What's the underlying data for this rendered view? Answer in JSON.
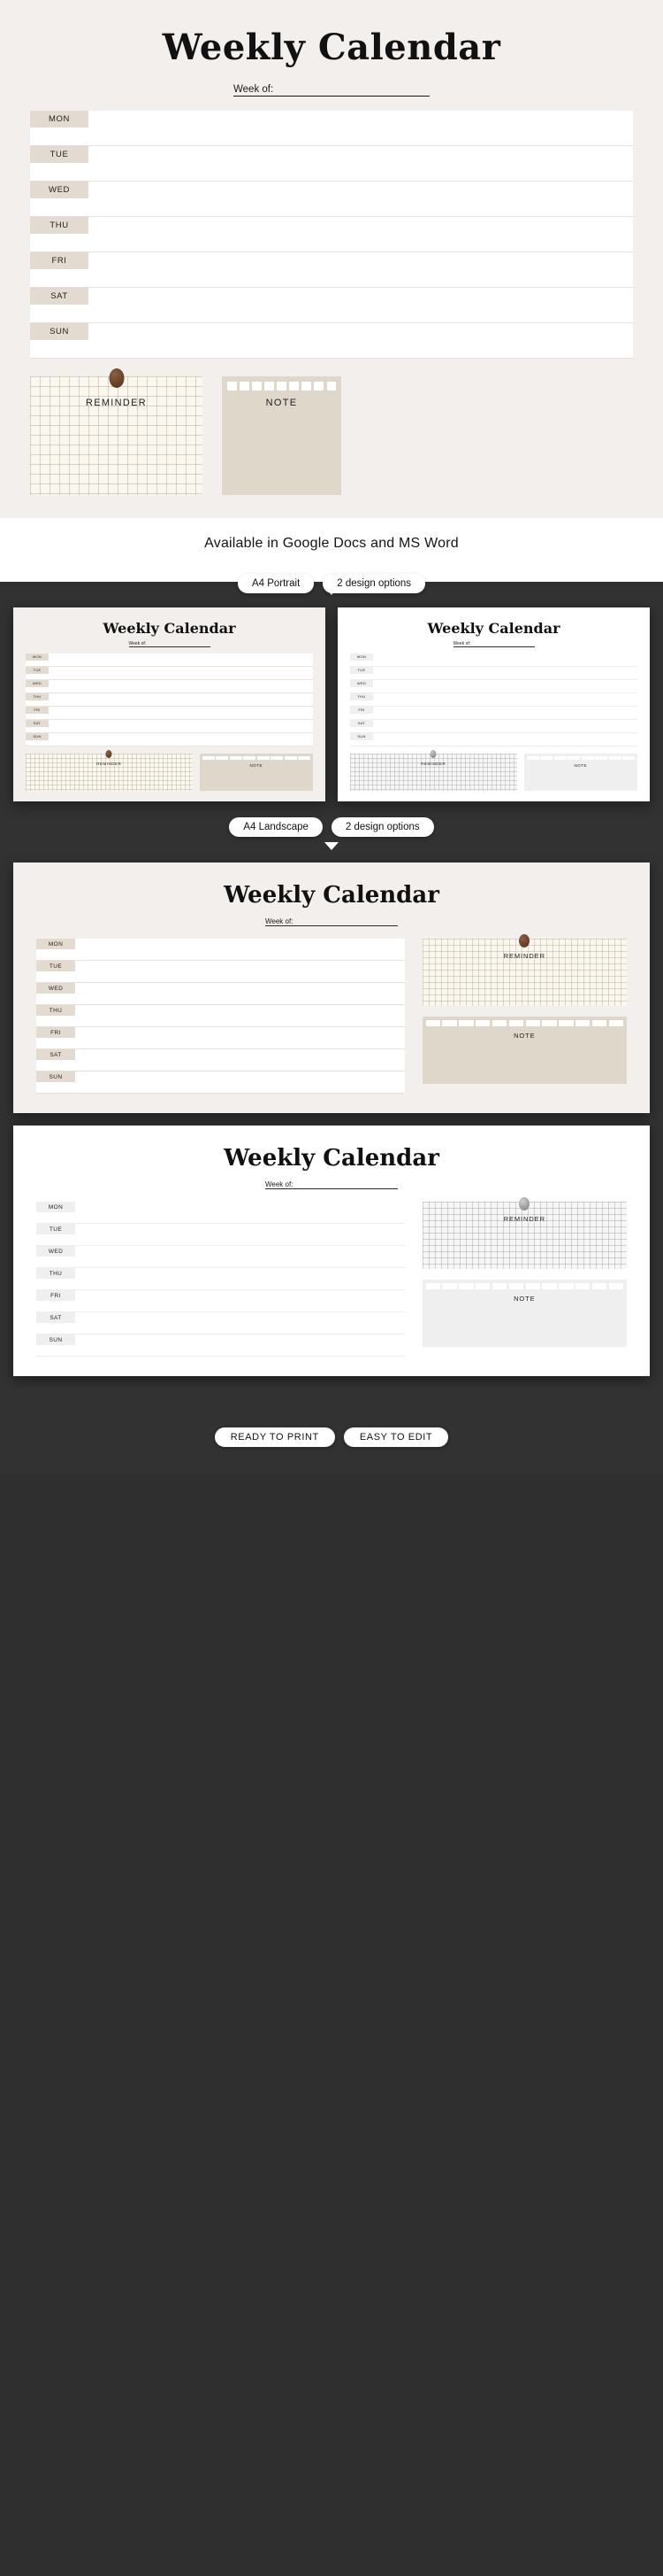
{
  "hero": {
    "title": "Weekly Calendar",
    "week_of_label": "Week of:",
    "days": [
      "MON",
      "TUE",
      "WED",
      "THU",
      "FRI",
      "SAT",
      "SUN"
    ],
    "reminder_label": "REMINDER",
    "note_label": "NOTE",
    "note_tab_count": 9,
    "colors": {
      "background": "#f2efec",
      "day_chip": "#e4dbd0",
      "row": "#ffffff",
      "note_card": "#e0d7cb",
      "reminder_card": "#faf7ef",
      "pin": "#6b4329"
    }
  },
  "band": {
    "heading": "Available in Google Docs and MS Word",
    "pills": [
      "A4 Portrait",
      "2 design options"
    ]
  },
  "portrait_section": {
    "previews": [
      {
        "variant": "beige",
        "title": "Weekly Calendar",
        "week_of_label": "Week of:",
        "days": [
          "MON",
          "TUE",
          "WED",
          "THU",
          "FRI",
          "SAT",
          "SUN"
        ],
        "reminder_label": "REMINDER",
        "note_label": "NOTE",
        "note_tab_count": 8
      },
      {
        "variant": "white",
        "title": "Weekly Calendar",
        "week_of_label": "Week of:",
        "days": [
          "MON",
          "TUE",
          "WED",
          "THU",
          "FRI",
          "SAT",
          "SUN"
        ],
        "reminder_label": "REMINDER",
        "note_label": "NOTE",
        "note_tab_count": 8
      }
    ]
  },
  "landscape_section": {
    "pills": [
      "A4 Landscape",
      "2 design options"
    ],
    "previews": [
      {
        "variant": "beige",
        "title": "Weekly Calendar",
        "week_of_label": "Week of:",
        "days": [
          "MON",
          "TUE",
          "WED",
          "THU",
          "FRI",
          "SAT",
          "SUN"
        ],
        "reminder_label": "REMINDER",
        "note_label": "NOTE",
        "note_tab_count": 12
      },
      {
        "variant": "white",
        "title": "Weekly Calendar",
        "week_of_label": "Week of:",
        "days": [
          "MON",
          "TUE",
          "WED",
          "THU",
          "FRI",
          "SAT",
          "SUN"
        ],
        "reminder_label": "REMINDER",
        "note_label": "NOTE",
        "note_tab_count": 12
      }
    ]
  },
  "footer": {
    "pills": [
      "READY TO PRINT",
      "EASY TO EDIT"
    ]
  }
}
